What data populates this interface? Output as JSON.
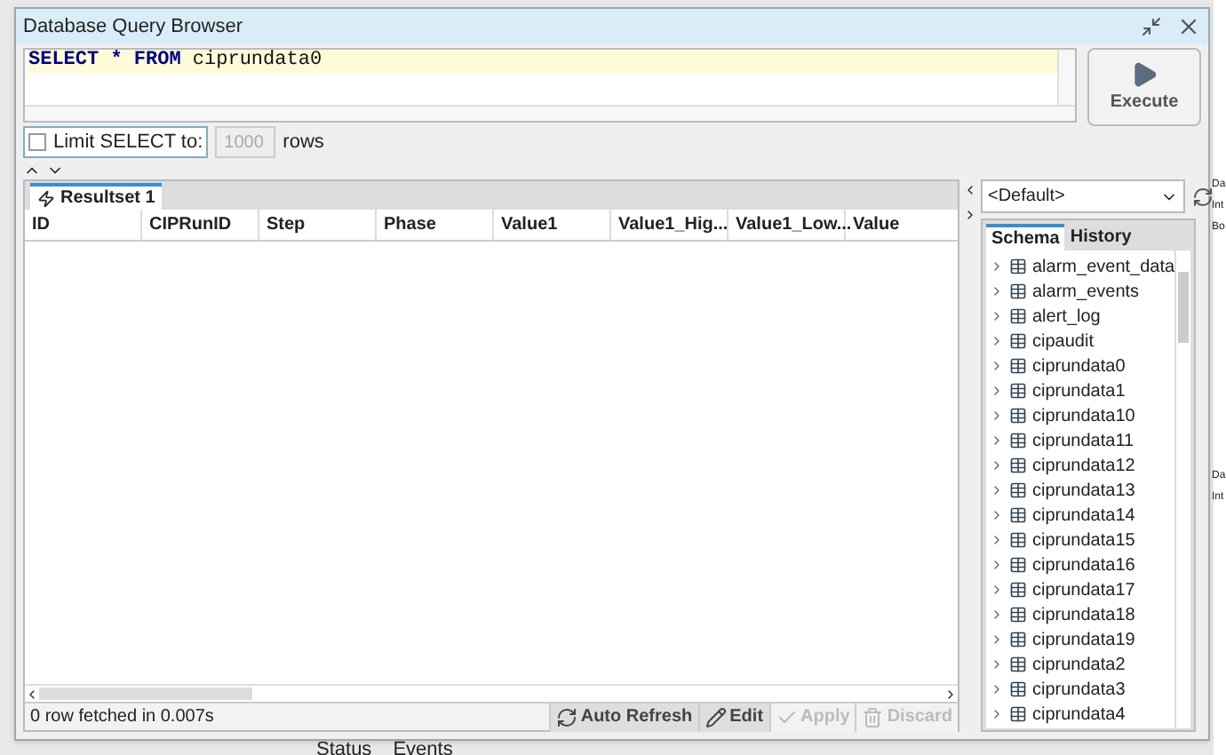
{
  "background": {
    "side_texts": [
      "Da",
      "Int",
      "Bo",
      "Da",
      "Int"
    ],
    "bottom_tabs": [
      "Status",
      "Events"
    ]
  },
  "window": {
    "title": "Database Query Browser"
  },
  "query": {
    "tokens": [
      {
        "text": "SELECT * FROM",
        "kind": "keyword"
      },
      {
        "text": " ciprundata0",
        "kind": "plain"
      }
    ]
  },
  "execute_button": "Execute",
  "limit": {
    "label": "Limit SELECT to:",
    "checked": false,
    "value": "1000",
    "disabled": true,
    "suffix": "rows"
  },
  "results": {
    "tabs": [
      {
        "label": "Resultset 1",
        "selected": true
      }
    ],
    "columns": [
      "ID",
      "CIPRunID",
      "Step",
      "Phase",
      "Value1",
      "Value1_Hig...",
      "Value1_Low...",
      "Value"
    ],
    "status": "0 row fetched in 0.007s",
    "buttons": [
      {
        "label": "Auto Refresh",
        "kind": "refresh",
        "disabled": false
      },
      {
        "label": "Edit",
        "kind": "edit",
        "disabled": false
      },
      {
        "label": "Apply",
        "kind": "check",
        "disabled": true
      },
      {
        "label": "Discard",
        "kind": "trash",
        "disabled": true
      }
    ]
  },
  "schema_panel": {
    "datasource": "<Default>",
    "tabs": [
      {
        "label": "Schema",
        "selected": true
      },
      {
        "label": "History",
        "selected": false
      }
    ],
    "tables": [
      "alarm_event_data",
      "alarm_events",
      "alert_log",
      "cipaudit",
      "ciprundata0",
      "ciprundata1",
      "ciprundata10",
      "ciprundata11",
      "ciprundata12",
      "ciprundata13",
      "ciprundata14",
      "ciprundata15",
      "ciprundata16",
      "ciprundata17",
      "ciprundata18",
      "ciprundata19",
      "ciprundata2",
      "ciprundata3",
      "ciprundata4"
    ]
  }
}
